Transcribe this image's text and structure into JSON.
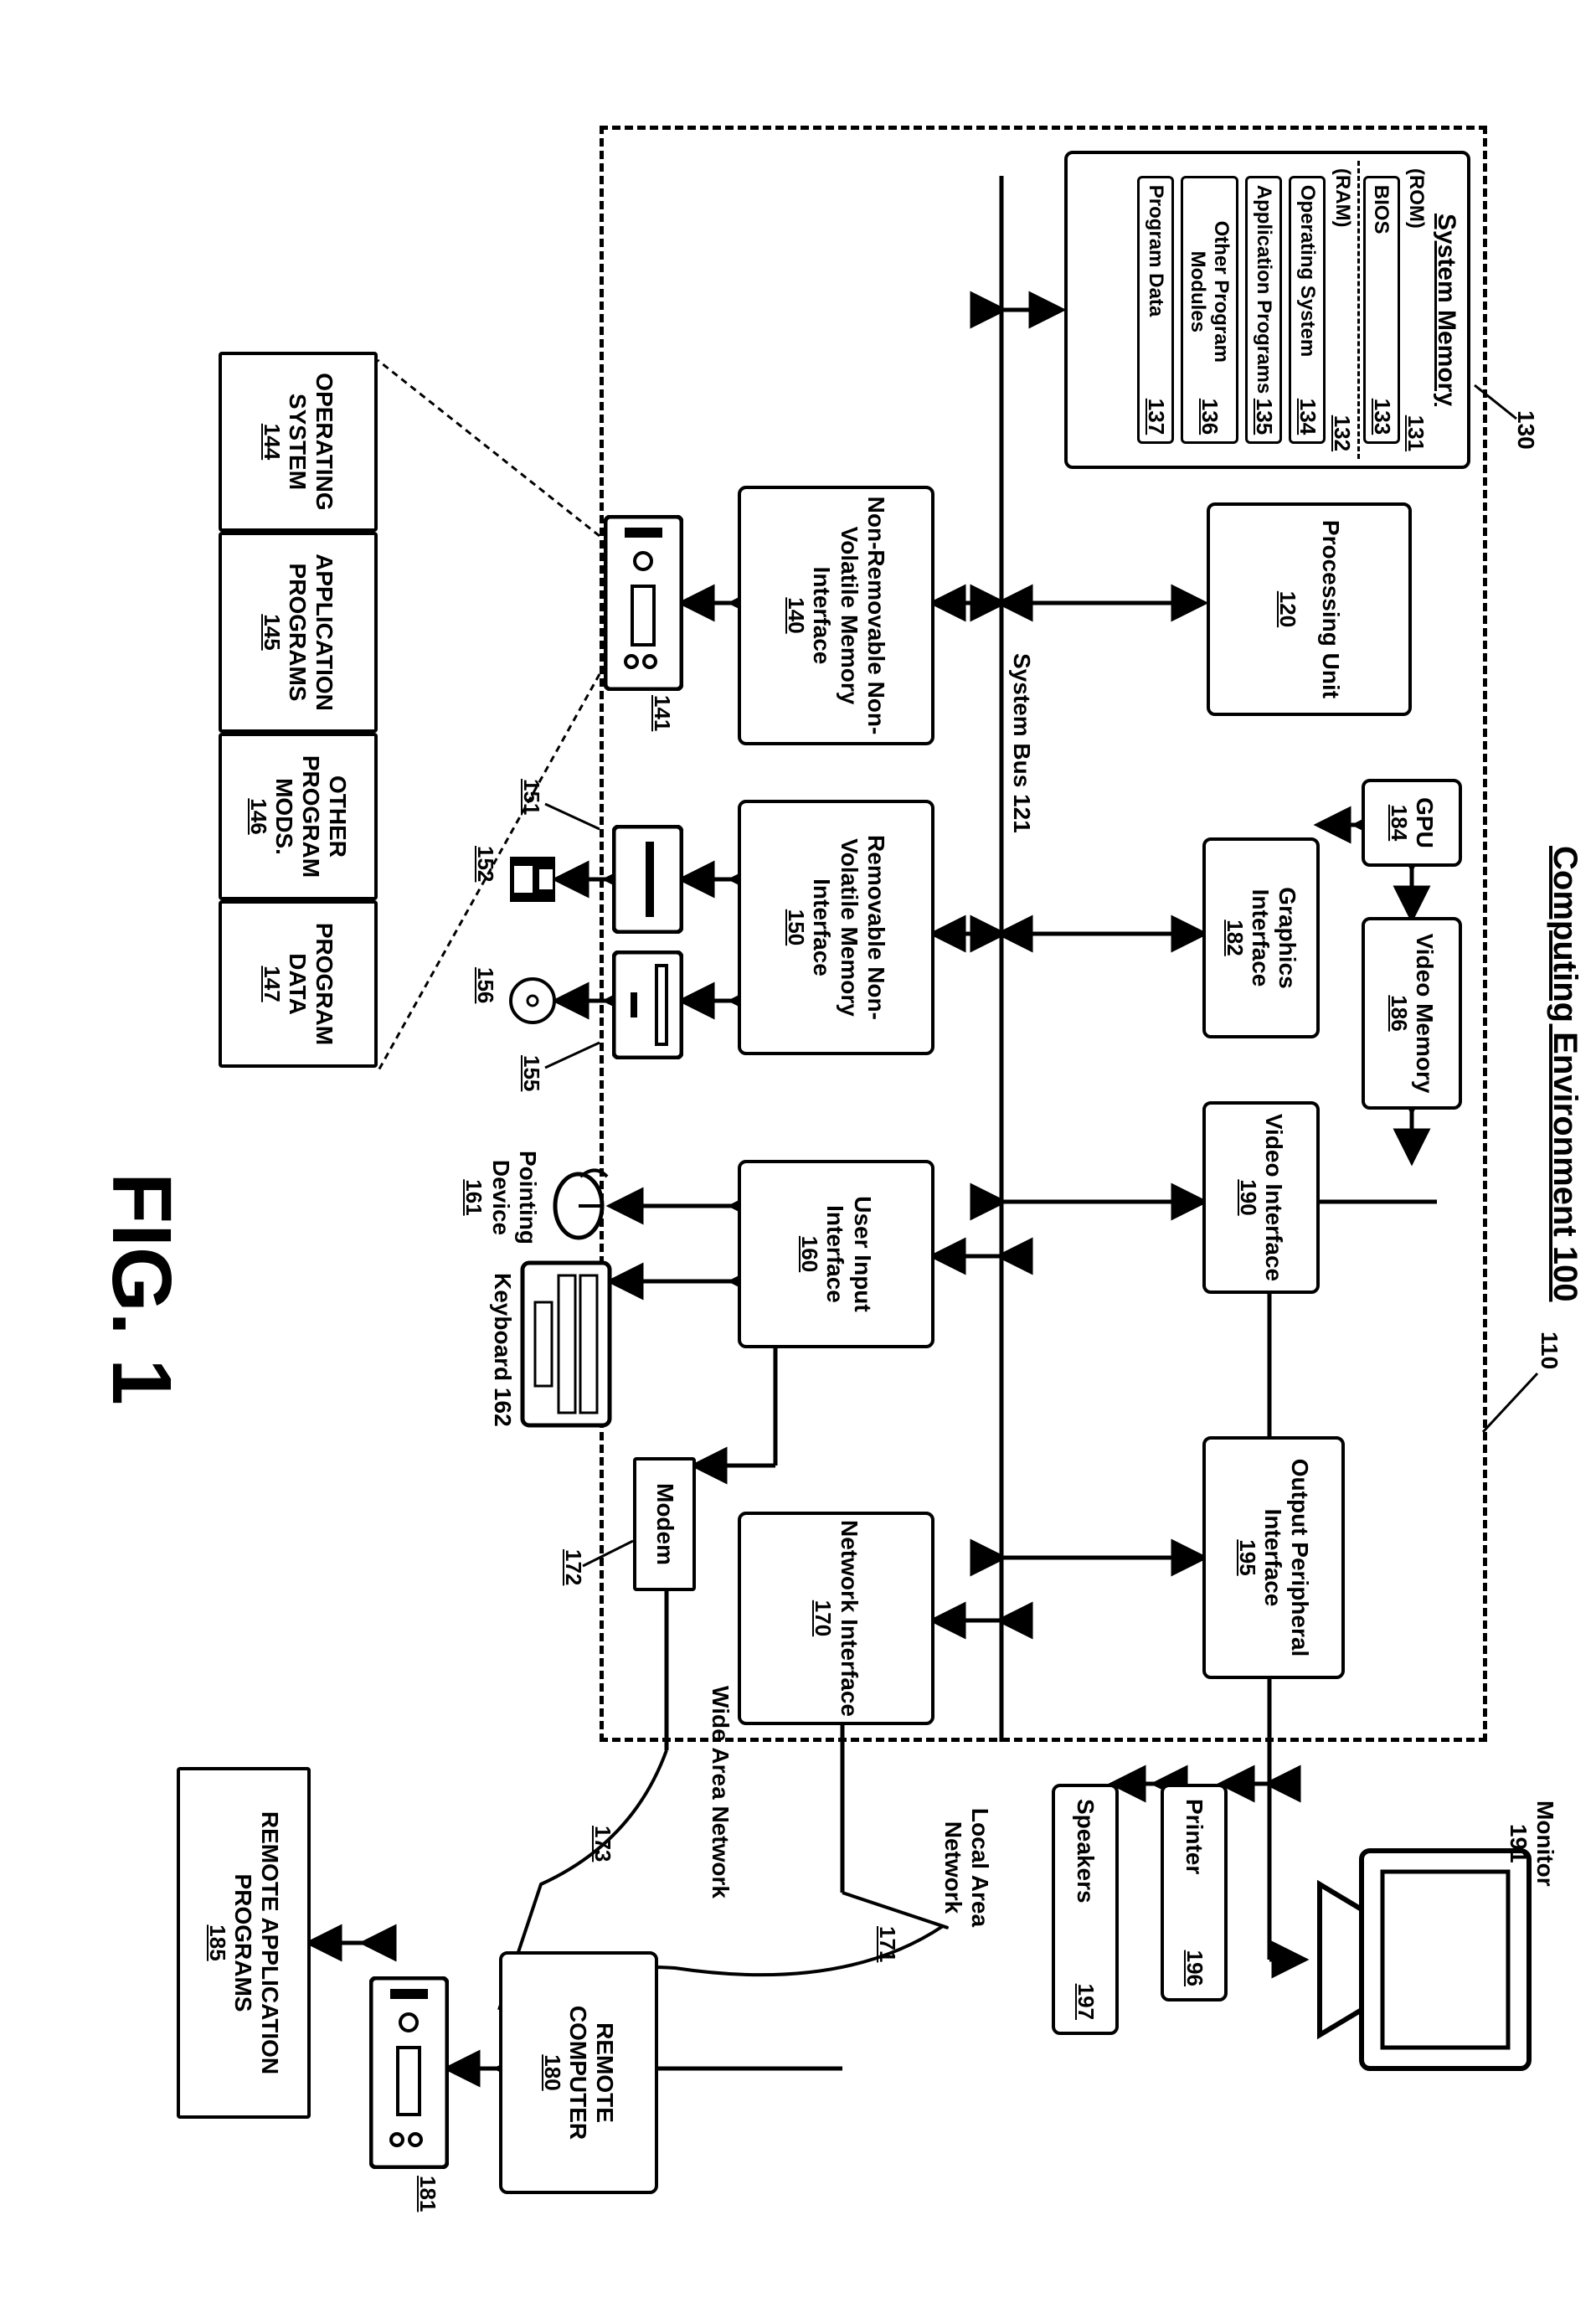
{
  "title": "Computing Environment 100",
  "figure": "FIG. 1",
  "labels": {
    "system_bus": "System Bus 121",
    "lan": "Local Area Network",
    "wan": "Wide Area Network",
    "keyboard": "Keyboard 162",
    "pointing": "Pointing Device",
    "env_lead": "110"
  },
  "nums": {
    "lan": "171",
    "wan": "173",
    "modem_n": "172",
    "pointing": "161",
    "floppy_n": "152",
    "cd_n": "156",
    "drive1": "151",
    "drive2": "155",
    "hd": "141",
    "sysmem_lead": "130"
  },
  "sysmem": {
    "title": "System Memory",
    "rom": "(ROM)",
    "rom_n": "131",
    "bios": "BIOS",
    "bios_n": "133",
    "ram": "(RAM)",
    "ram_n": "132",
    "os": "Operating System",
    "os_n": "134",
    "app": "Application Programs",
    "app_n": "135",
    "mods": "Other Program Modules",
    "mods_n": "136",
    "data": "Program Data",
    "data_n": "137"
  },
  "blocks": {
    "proc": "Processing Unit",
    "proc_n": "120",
    "gpu": "GPU",
    "gpu_n": "184",
    "vmem": "Video Memory",
    "vmem_n": "186",
    "gint": "Graphics Interface",
    "gint_n": "182",
    "vint": "Video Interface",
    "vint_n": "190",
    "opi": "Output Peripheral Interface",
    "opi_n": "195",
    "nrmi": "Non-Removable Non-Volatile Memory Interface",
    "nrmi_n": "140",
    "rmi": "Removable Non-Volatile Memory Interface",
    "rmi_n": "150",
    "uii": "User Input Interface",
    "uii_n": "160",
    "ni": "Network Interface",
    "ni_n": "170",
    "modem": "Modem",
    "monitor": "Monitor 191",
    "printer": "Printer",
    "printer_n": "196",
    "speakers": "Speakers",
    "speakers_n": "197",
    "remote": "REMOTE COMPUTER",
    "remote_n": "180",
    "rap": "REMOTE APPLICATION PROGRAMS",
    "rap_n": "185",
    "remdev_n": "181"
  },
  "bottom": {
    "os": "OPERATING SYSTEM",
    "os_n": "144",
    "app": "APPLICATION PROGRAMS",
    "app_n": "145",
    "mods": "OTHER PROGRAM MODS.",
    "mods_n": "146",
    "data": "PROGRAM DATA",
    "data_n": "147"
  }
}
